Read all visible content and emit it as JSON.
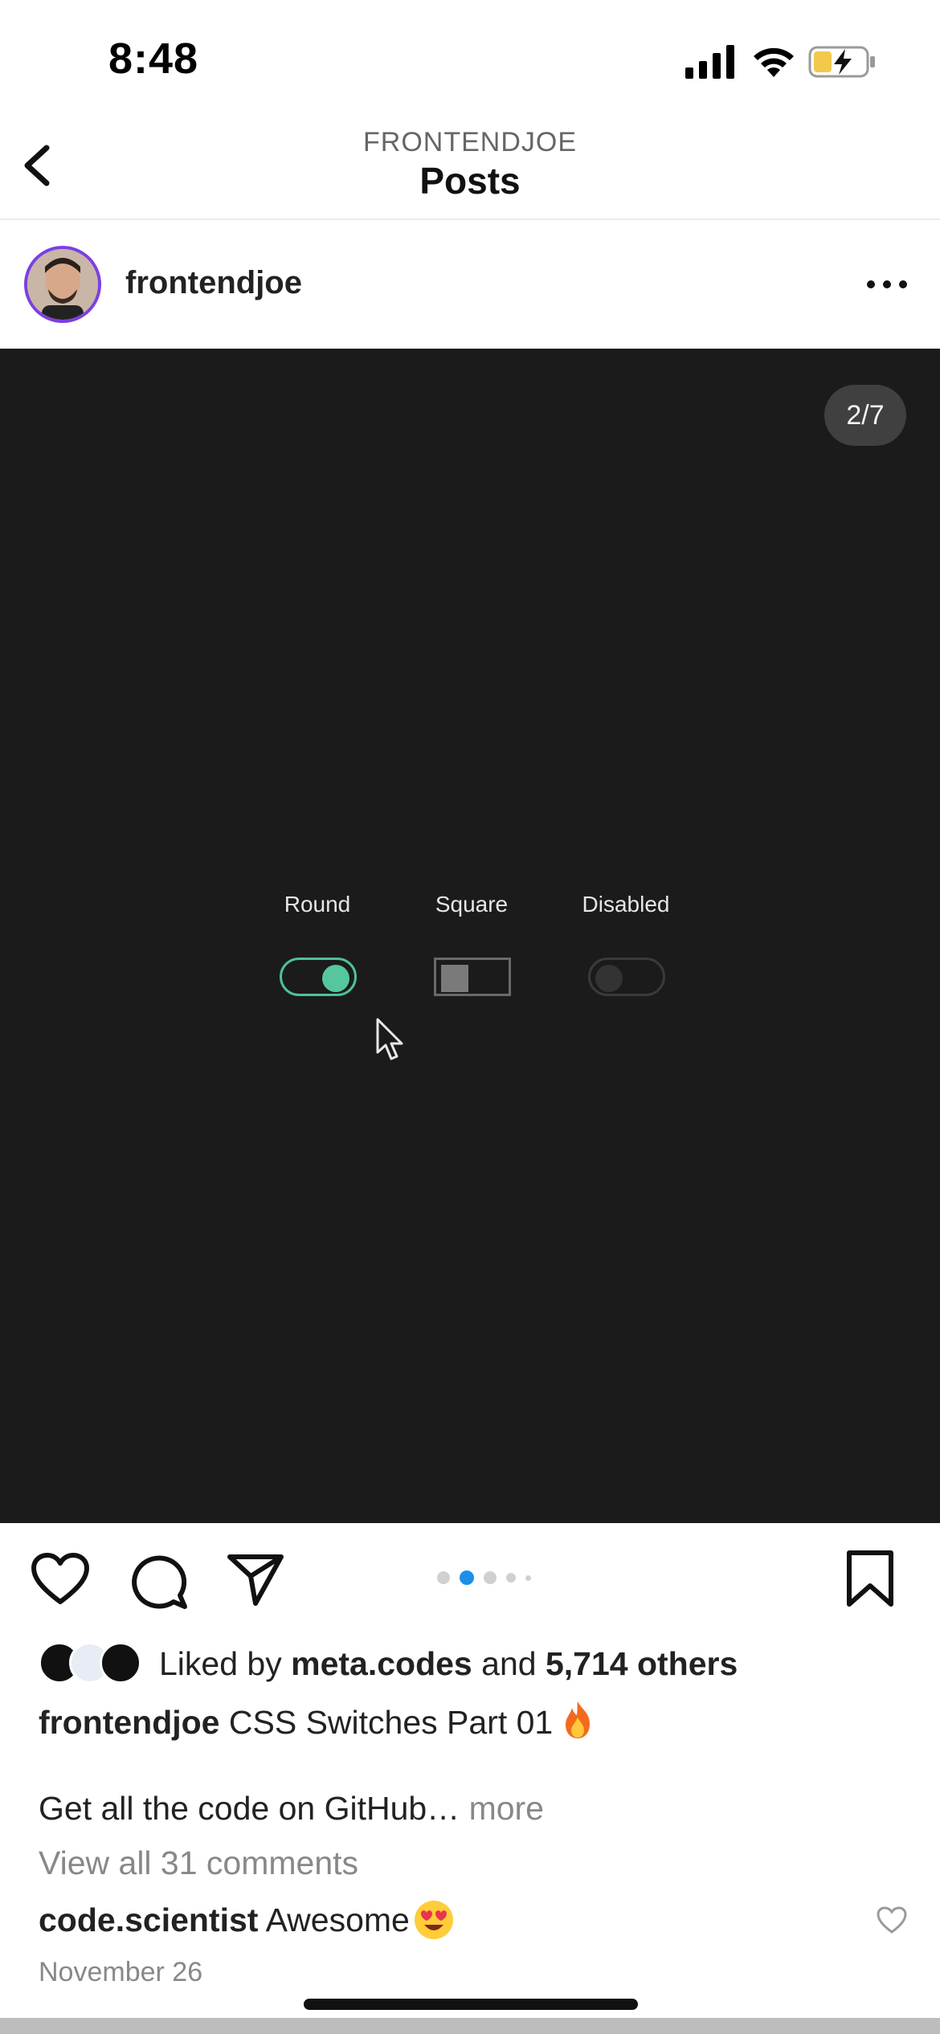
{
  "status_bar": {
    "time": "8:48"
  },
  "header": {
    "subtitle": "FRONTENDJOE",
    "title": "Posts"
  },
  "post": {
    "author": "frontendjoe",
    "media": {
      "counter": "2/7",
      "switches": [
        {
          "label": "Round",
          "state": "on"
        },
        {
          "label": "Square",
          "state": "off"
        },
        {
          "label": "Disabled",
          "state": "disabled"
        }
      ],
      "carousel_dots": 5,
      "active_dot": 2
    },
    "likes": {
      "prefix": "Liked by",
      "user": "meta.codes",
      "joiner": "and",
      "others": "5,714 others"
    },
    "caption": {
      "author": "frontendjoe",
      "text": "CSS Switches Part 01",
      "second_line": "Get all the code on GitHub…",
      "more": "more"
    },
    "view_comments": "View all 31 comments",
    "comment": {
      "author": "code.scientist",
      "text": "Awesome"
    },
    "date": "November 26"
  },
  "colors": {
    "media_bg": "#1b1b1c",
    "switch_on": "#4fc19a",
    "active_dot": "#1d8fe8",
    "avatar_ring": "#7b3fe4"
  }
}
